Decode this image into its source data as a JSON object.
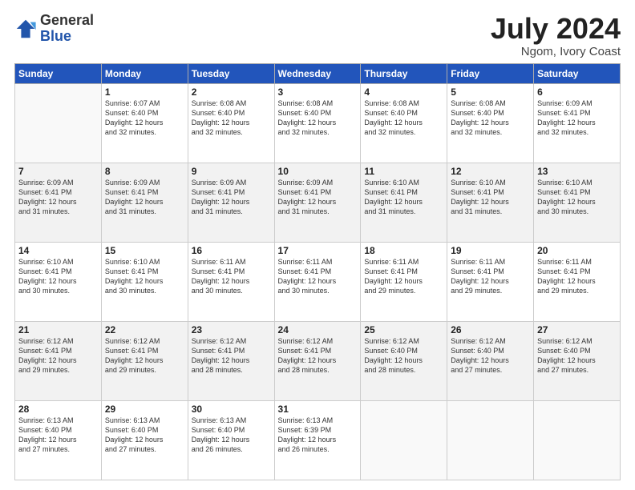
{
  "header": {
    "logo_general": "General",
    "logo_blue": "Blue",
    "title": "July 2024",
    "location": "Ngom, Ivory Coast"
  },
  "days_of_week": [
    "Sunday",
    "Monday",
    "Tuesday",
    "Wednesday",
    "Thursday",
    "Friday",
    "Saturday"
  ],
  "weeks": [
    [
      {
        "day": "",
        "sunrise": "",
        "sunset": "",
        "daylight": ""
      },
      {
        "day": "1",
        "sunrise": "6:07 AM",
        "sunset": "6:40 PM",
        "daylight": "12 hours and 32 minutes."
      },
      {
        "day": "2",
        "sunrise": "6:08 AM",
        "sunset": "6:40 PM",
        "daylight": "12 hours and 32 minutes."
      },
      {
        "day": "3",
        "sunrise": "6:08 AM",
        "sunset": "6:40 PM",
        "daylight": "12 hours and 32 minutes."
      },
      {
        "day": "4",
        "sunrise": "6:08 AM",
        "sunset": "6:40 PM",
        "daylight": "12 hours and 32 minutes."
      },
      {
        "day": "5",
        "sunrise": "6:08 AM",
        "sunset": "6:40 PM",
        "daylight": "12 hours and 32 minutes."
      },
      {
        "day": "6",
        "sunrise": "6:09 AM",
        "sunset": "6:41 PM",
        "daylight": "12 hours and 32 minutes."
      }
    ],
    [
      {
        "day": "7",
        "sunrise": "6:09 AM",
        "sunset": "6:41 PM",
        "daylight": "12 hours and 31 minutes."
      },
      {
        "day": "8",
        "sunrise": "6:09 AM",
        "sunset": "6:41 PM",
        "daylight": "12 hours and 31 minutes."
      },
      {
        "day": "9",
        "sunrise": "6:09 AM",
        "sunset": "6:41 PM",
        "daylight": "12 hours and 31 minutes."
      },
      {
        "day": "10",
        "sunrise": "6:09 AM",
        "sunset": "6:41 PM",
        "daylight": "12 hours and 31 minutes."
      },
      {
        "day": "11",
        "sunrise": "6:10 AM",
        "sunset": "6:41 PM",
        "daylight": "12 hours and 31 minutes."
      },
      {
        "day": "12",
        "sunrise": "6:10 AM",
        "sunset": "6:41 PM",
        "daylight": "12 hours and 31 minutes."
      },
      {
        "day": "13",
        "sunrise": "6:10 AM",
        "sunset": "6:41 PM",
        "daylight": "12 hours and 30 minutes."
      }
    ],
    [
      {
        "day": "14",
        "sunrise": "6:10 AM",
        "sunset": "6:41 PM",
        "daylight": "12 hours and 30 minutes."
      },
      {
        "day": "15",
        "sunrise": "6:10 AM",
        "sunset": "6:41 PM",
        "daylight": "12 hours and 30 minutes."
      },
      {
        "day": "16",
        "sunrise": "6:11 AM",
        "sunset": "6:41 PM",
        "daylight": "12 hours and 30 minutes."
      },
      {
        "day": "17",
        "sunrise": "6:11 AM",
        "sunset": "6:41 PM",
        "daylight": "12 hours and 30 minutes."
      },
      {
        "day": "18",
        "sunrise": "6:11 AM",
        "sunset": "6:41 PM",
        "daylight": "12 hours and 29 minutes."
      },
      {
        "day": "19",
        "sunrise": "6:11 AM",
        "sunset": "6:41 PM",
        "daylight": "12 hours and 29 minutes."
      },
      {
        "day": "20",
        "sunrise": "6:11 AM",
        "sunset": "6:41 PM",
        "daylight": "12 hours and 29 minutes."
      }
    ],
    [
      {
        "day": "21",
        "sunrise": "6:12 AM",
        "sunset": "6:41 PM",
        "daylight": "12 hours and 29 minutes."
      },
      {
        "day": "22",
        "sunrise": "6:12 AM",
        "sunset": "6:41 PM",
        "daylight": "12 hours and 29 minutes."
      },
      {
        "day": "23",
        "sunrise": "6:12 AM",
        "sunset": "6:41 PM",
        "daylight": "12 hours and 28 minutes."
      },
      {
        "day": "24",
        "sunrise": "6:12 AM",
        "sunset": "6:41 PM",
        "daylight": "12 hours and 28 minutes."
      },
      {
        "day": "25",
        "sunrise": "6:12 AM",
        "sunset": "6:40 PM",
        "daylight": "12 hours and 28 minutes."
      },
      {
        "day": "26",
        "sunrise": "6:12 AM",
        "sunset": "6:40 PM",
        "daylight": "12 hours and 27 minutes."
      },
      {
        "day": "27",
        "sunrise": "6:12 AM",
        "sunset": "6:40 PM",
        "daylight": "12 hours and 27 minutes."
      }
    ],
    [
      {
        "day": "28",
        "sunrise": "6:13 AM",
        "sunset": "6:40 PM",
        "daylight": "12 hours and 27 minutes."
      },
      {
        "day": "29",
        "sunrise": "6:13 AM",
        "sunset": "6:40 PM",
        "daylight": "12 hours and 27 minutes."
      },
      {
        "day": "30",
        "sunrise": "6:13 AM",
        "sunset": "6:40 PM",
        "daylight": "12 hours and 26 minutes."
      },
      {
        "day": "31",
        "sunrise": "6:13 AM",
        "sunset": "6:39 PM",
        "daylight": "12 hours and 26 minutes."
      },
      {
        "day": "",
        "sunrise": "",
        "sunset": "",
        "daylight": ""
      },
      {
        "day": "",
        "sunrise": "",
        "sunset": "",
        "daylight": ""
      },
      {
        "day": "",
        "sunrise": "",
        "sunset": "",
        "daylight": ""
      }
    ]
  ]
}
